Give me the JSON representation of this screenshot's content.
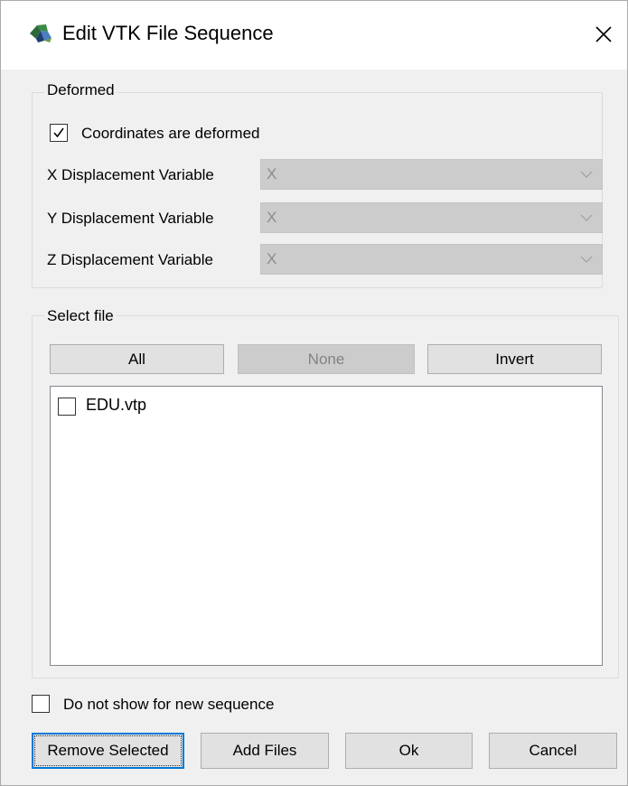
{
  "window": {
    "title": "Edit VTK File Sequence"
  },
  "deformed": {
    "group_title": "Deformed",
    "coords_checkbox": {
      "label": "Coordinates are deformed",
      "checked": true
    },
    "rows": [
      {
        "label": "X Displacement Variable",
        "value": "X"
      },
      {
        "label": "Y Displacement Variable",
        "value": "X"
      },
      {
        "label": "Z Displacement Variable",
        "value": "X"
      }
    ]
  },
  "select_file": {
    "group_title": "Select file",
    "all_label": "All",
    "none_label": "None",
    "invert_label": "Invert",
    "files": [
      {
        "name": "EDU.vtp",
        "checked": false
      }
    ]
  },
  "options": {
    "do_not_show_label": "Do not show for new sequence",
    "do_not_show_checked": false
  },
  "buttons": {
    "remove_selected": "Remove Selected",
    "add_files": "Add Files",
    "ok": "Ok",
    "cancel": "Cancel"
  },
  "colors": {
    "focus_border": "#0078d7",
    "window_bg": "#f0f0f0",
    "disabled_bg": "#cccccc"
  },
  "icons": {
    "app": "vtk-app-icon",
    "close": "close-icon",
    "check": "checkmark-icon",
    "dropdown": "chevron-down-icon"
  }
}
